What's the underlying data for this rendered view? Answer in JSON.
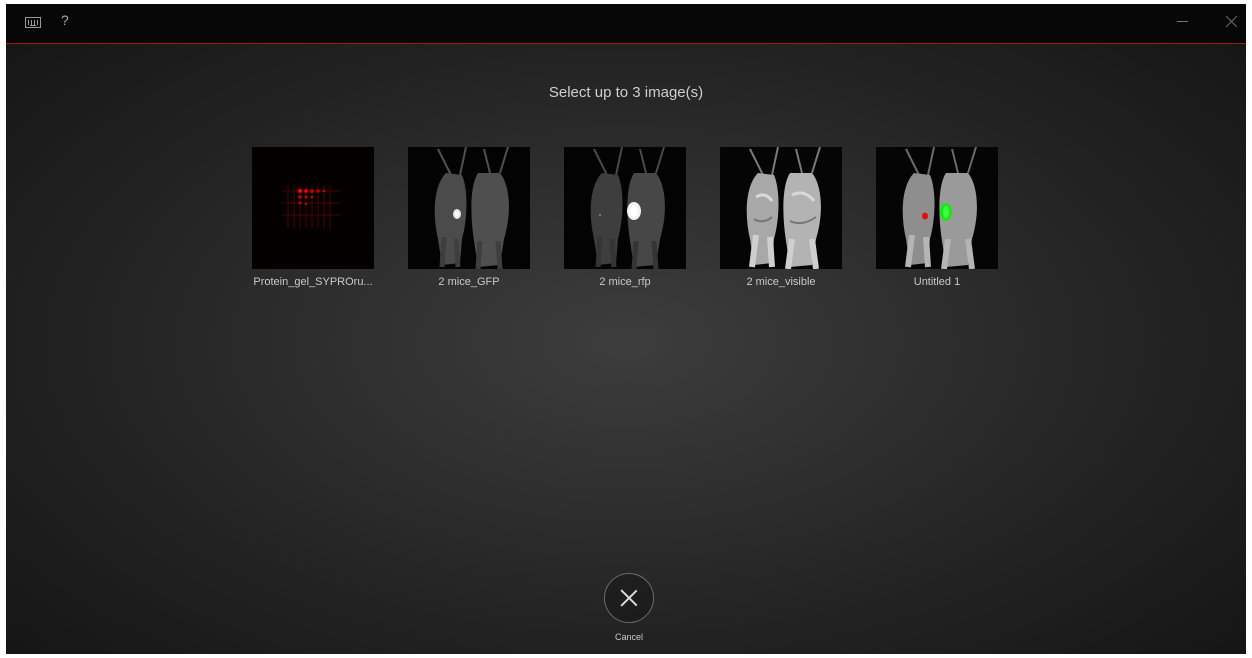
{
  "titlebar": {
    "keyboard_icon": "keyboard-icon",
    "help_label": "?",
    "minimize_icon": "minimize-icon",
    "close_icon": "close-icon",
    "accent_color": "#a31616"
  },
  "prompt": "Select up to 3 image(s)",
  "images": [
    {
      "caption": "Protein_gel_SYPROru..."
    },
    {
      "caption": "2 mice_GFP"
    },
    {
      "caption": "2 mice_rfp"
    },
    {
      "caption": "2 mice_visible"
    },
    {
      "caption": "Untitled 1"
    }
  ],
  "cancel": {
    "icon": "close-icon",
    "label": "Cancel"
  }
}
